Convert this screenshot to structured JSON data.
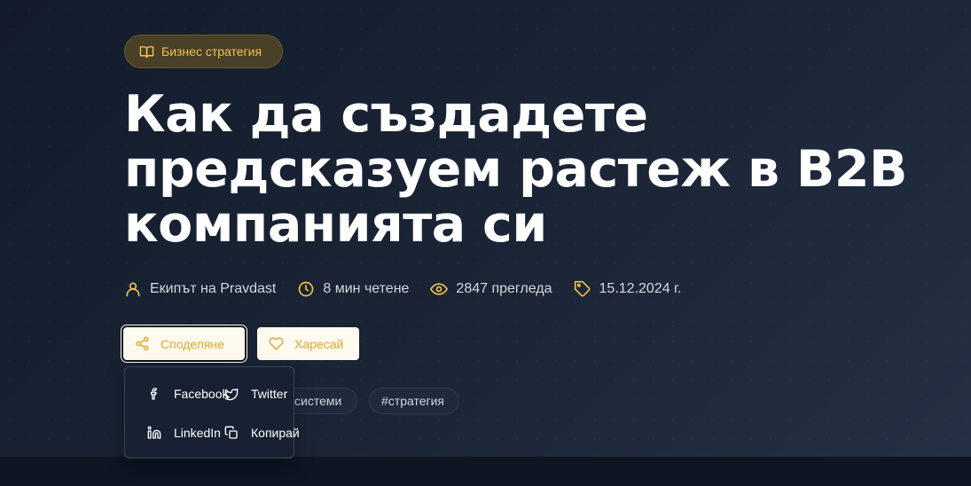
{
  "category": {
    "label": "Бизнес стратегия",
    "icon": "book-open-icon"
  },
  "title": "Как да създадете предсказуем растеж в B2B компанията си",
  "meta": {
    "author": "Екипът на Pravdast",
    "read_time": "8 мин четене",
    "views": "2847 прегледа",
    "date": "15.12.2024 г."
  },
  "actions": {
    "share_label": "Споделяне",
    "like_label": "Харесай"
  },
  "share_menu": {
    "facebook": "Facebook",
    "twitter": "Twitter",
    "linkedin": "LinkedIn",
    "copy": "Копирай"
  },
  "tags": [
    "системи",
    "#стратегия"
  ],
  "colors": {
    "accent": "#f2c14e",
    "button_text": "#e2a72a",
    "background": "#1b2536",
    "menu_bg": "#172133"
  }
}
